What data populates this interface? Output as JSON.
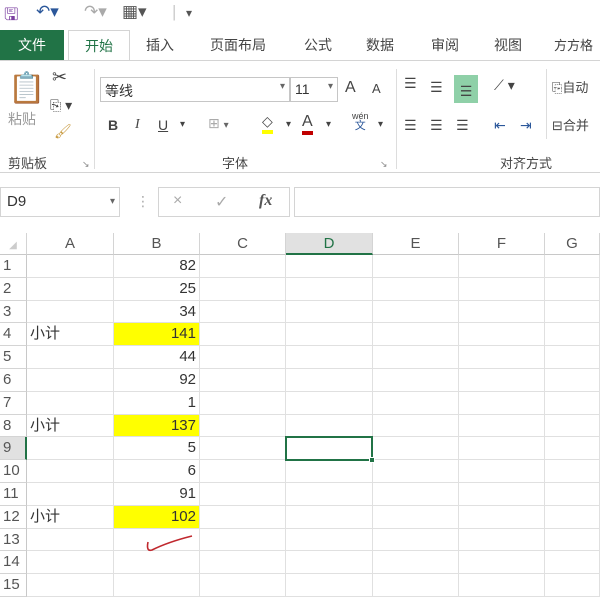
{
  "quick_access": {
    "icons": [
      "save-icon",
      "undo-icon",
      "redo-icon",
      "form-icon",
      "customize-icon"
    ]
  },
  "tabs": [
    "文件",
    "开始",
    "插入",
    "页面布局",
    "公式",
    "数据",
    "审阅",
    "视图",
    "方方格"
  ],
  "ribbon": {
    "clipboard": {
      "paste": "粘贴",
      "group": "剪贴板"
    },
    "font": {
      "name": "等线",
      "size": "11",
      "bold": "B",
      "italic": "I",
      "underline": "U",
      "grow": "A",
      "shrink": "A",
      "phonetic": "wén",
      "phonetic_char": "文",
      "group": "字体"
    },
    "alignment": {
      "wrap": "自动",
      "merge": "合并",
      "group": "对齐方式"
    },
    "colors": {
      "fill": "#ffff00",
      "font": "#c00000",
      "accent": "#217346"
    }
  },
  "formula_bar": {
    "name_box": "D9",
    "cancel": "×",
    "enter": "✓",
    "fx": "fx",
    "value": ""
  },
  "columns": [
    "A",
    "B",
    "C",
    "D",
    "E",
    "F",
    "G"
  ],
  "selected_column": "D",
  "selected_row": 9,
  "rows": [
    {
      "n": "1",
      "a": "",
      "b": "82",
      "hl": false
    },
    {
      "n": "2",
      "a": "",
      "b": "25",
      "hl": false
    },
    {
      "n": "3",
      "a": "",
      "b": "34",
      "hl": false
    },
    {
      "n": "4",
      "a": "小计",
      "b": "141",
      "hl": true
    },
    {
      "n": "5",
      "a": "",
      "b": "44",
      "hl": false
    },
    {
      "n": "6",
      "a": "",
      "b": "92",
      "hl": false
    },
    {
      "n": "7",
      "a": "",
      "b": "1",
      "hl": false
    },
    {
      "n": "8",
      "a": "小计",
      "b": "137",
      "hl": true
    },
    {
      "n": "9",
      "a": "",
      "b": "5",
      "hl": false
    },
    {
      "n": "10",
      "a": "",
      "b": "6",
      "hl": false
    },
    {
      "n": "11",
      "a": "",
      "b": "91",
      "hl": false
    },
    {
      "n": "12",
      "a": "小计",
      "b": "102",
      "hl": true
    },
    {
      "n": "13",
      "a": "",
      "b": "",
      "hl": false
    },
    {
      "n": "14",
      "a": "",
      "b": "",
      "hl": false
    },
    {
      "n": "15",
      "a": "",
      "b": "",
      "hl": false
    }
  ]
}
